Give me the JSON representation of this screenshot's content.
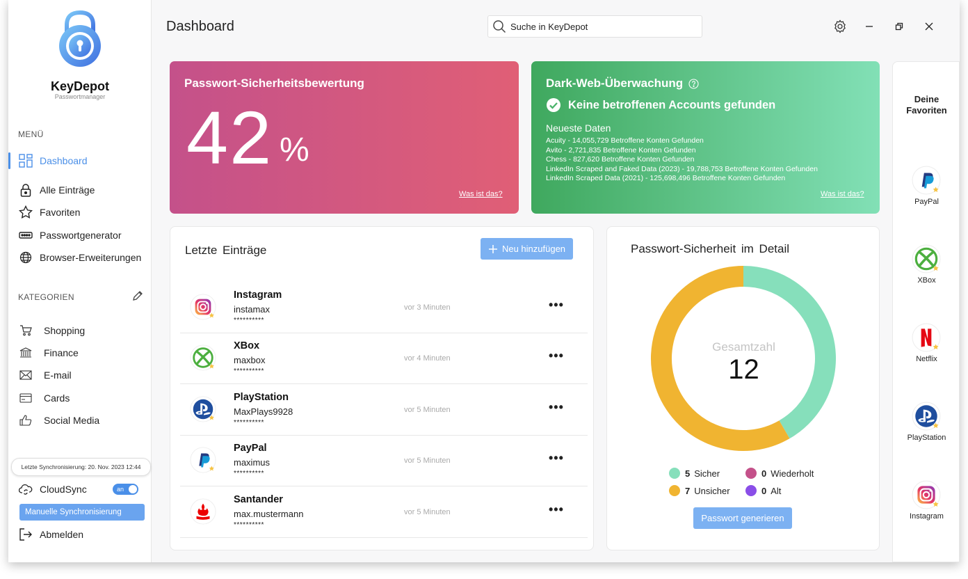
{
  "app": {
    "name": "KeyDepot",
    "subtitle": "Passwortmanager"
  },
  "header": {
    "title": "Dashboard",
    "search_value": "Suche in KeyDepot"
  },
  "sidebar": {
    "menu_label": "MENÜ",
    "nav": [
      {
        "label": "Dashboard",
        "icon": "grid-icon",
        "active": true
      },
      {
        "label": "Alle Einträge",
        "icon": "lock-icon"
      },
      {
        "label": "Favoriten",
        "icon": "star-icon"
      },
      {
        "label": "Passwortgenerator",
        "icon": "password-icon"
      },
      {
        "label": "Browser-Erweiterungen",
        "icon": "globe-icon"
      }
    ],
    "categories_label": "KATEGORIEN",
    "categories": [
      {
        "label": "Shopping",
        "icon": "cart-icon"
      },
      {
        "label": "Finance",
        "icon": "bank-icon"
      },
      {
        "label": "E-mail",
        "icon": "mail-icon"
      },
      {
        "label": "Cards",
        "icon": "card-icon"
      },
      {
        "label": "Social Media",
        "icon": "thumbs-up-icon"
      }
    ],
    "last_sync": "Letzte Synchronisierung: 20. Nov. 2023 12:44",
    "cloudsync_label": "CloudSync",
    "cloudsync_toggle": "an",
    "manual_sync_label": "Manuelle Synchronisierung",
    "logout_label": "Abmelden"
  },
  "score_card": {
    "title": "Passwort-Sicherheitsbewertung",
    "value": "42",
    "unit": "%",
    "link": "Was ist das?",
    "gradient": [
      "#c4518a",
      "#e05f76"
    ]
  },
  "darkweb_card": {
    "title": "Dark-Web-Überwachung",
    "status": "Keine betroffenen Accounts gefunden",
    "subtitle": "Neueste Daten",
    "items": [
      "Acuity - 14,055,729 Betroffene Konten Gefunden",
      "Avito - 2,721,835 Betroffene Konten Gefunden",
      "Chess - 827,620 Betroffene Konten Gefunden",
      "LinkedIn Scraped and Faked Data (2023) - 19,788,753 Betroffene Konten Gefunden",
      "LinkedIn Scraped Data (2021) - 125,698,496 Betroffene Konten Gefunden"
    ],
    "link": "Was ist das?"
  },
  "recent": {
    "title": "Letzte Einträge",
    "add_label": "Neu hinzufügen",
    "entries": [
      {
        "name": "Instagram",
        "user": "instamax",
        "password": "**********",
        "time": "vor 3 Minuten",
        "icon": "instagram-icon"
      },
      {
        "name": "XBox",
        "user": "maxbox",
        "password": "**********",
        "time": "vor 4 Minuten",
        "icon": "xbox-icon"
      },
      {
        "name": "PlayStation",
        "user": "MaxPlays9928",
        "password": "**********",
        "time": "vor 5 Minuten",
        "icon": "playstation-icon"
      },
      {
        "name": "PayPal",
        "user": "maximus",
        "password": "**********",
        "time": "vor 5 Minuten",
        "icon": "paypal-icon"
      },
      {
        "name": "Santander",
        "user": "max.mustermann",
        "password": "**********",
        "time": "vor 5 Minuten",
        "icon": "santander-icon"
      }
    ]
  },
  "detail": {
    "title": "Passwort-Sicherheit im Detail",
    "total_label": "Gesamtzahl",
    "total": "12",
    "legend": [
      {
        "count": "5",
        "label": "Sicher",
        "color": "#86dfbb"
      },
      {
        "count": "0",
        "label": "Wiederholt",
        "color": "#c4518a"
      },
      {
        "count": "7",
        "label": "Unsicher",
        "color": "#f0b431"
      },
      {
        "count": "0",
        "label": "Alt",
        "color": "#8a4ee8"
      }
    ],
    "generate_label": "Passwort generieren"
  },
  "chart_data": {
    "type": "pie",
    "categories": [
      "Sicher",
      "Wiederholt",
      "Unsicher",
      "Alt"
    ],
    "values": [
      5,
      0,
      7,
      0
    ],
    "colors": [
      "#86dfbb",
      "#c4518a",
      "#f0b431",
      "#8a4ee8"
    ]
  },
  "favorites": {
    "title": "Deine Favoriten",
    "items": [
      {
        "label": "PayPal",
        "icon": "paypal-icon"
      },
      {
        "label": "XBox",
        "icon": "xbox-icon"
      },
      {
        "label": "Netflix",
        "icon": "netflix-icon"
      },
      {
        "label": "PlayStation",
        "icon": "playstation-icon"
      },
      {
        "label": "Instagram",
        "icon": "instagram-icon"
      }
    ]
  },
  "colors": {
    "accent": "#4a8fe8",
    "button": "#7cb1f2"
  }
}
